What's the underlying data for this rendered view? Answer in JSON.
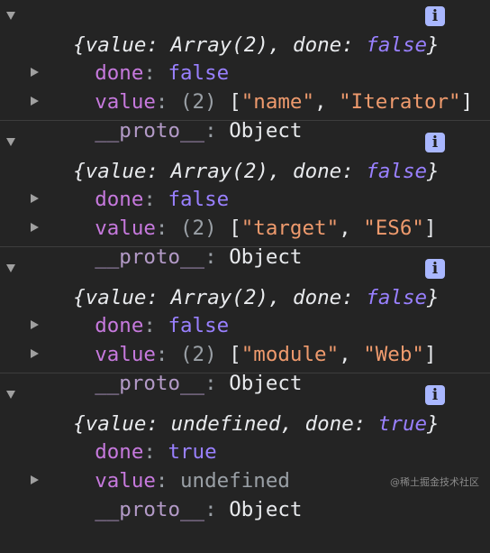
{
  "entries": [
    {
      "summary": "{value: Array(2), done: false}",
      "done_key": "done",
      "done_value": "false",
      "value_key": "value",
      "value_count": "(2)",
      "value_items": [
        "\"name\"",
        "\"Iterator\""
      ],
      "proto_key": "__proto__",
      "proto_value": "Object"
    },
    {
      "summary": "{value: Array(2), done: false}",
      "done_key": "done",
      "done_value": "false",
      "value_key": "value",
      "value_count": "(2)",
      "value_items": [
        "\"target\"",
        "\"ES6\""
      ],
      "proto_key": "__proto__",
      "proto_value": "Object"
    },
    {
      "summary": "{value: Array(2), done: false}",
      "done_key": "done",
      "done_value": "false",
      "value_key": "value",
      "value_count": "(2)",
      "value_items": [
        "\"module\"",
        "\"Web\""
      ],
      "proto_key": "__proto__",
      "proto_value": "Object"
    },
    {
      "summary": "{value: undefined, done: true}",
      "done_key": "done",
      "done_value": "true",
      "value_key": "value",
      "value_plain": "undefined",
      "proto_key": "__proto__",
      "proto_value": "Object"
    }
  ],
  "info_glyph": "i",
  "icons": {
    "expanded": "triangle-down-icon",
    "collapsed": "triangle-right-icon",
    "info": "info-icon"
  },
  "watermark": "@稀土掘金技术社区",
  "colors": {
    "background": "#242424",
    "key": "#c679dd",
    "boolean": "#9980ff",
    "string": "#ee9a6d",
    "info_badge": "#a9b7ff"
  }
}
